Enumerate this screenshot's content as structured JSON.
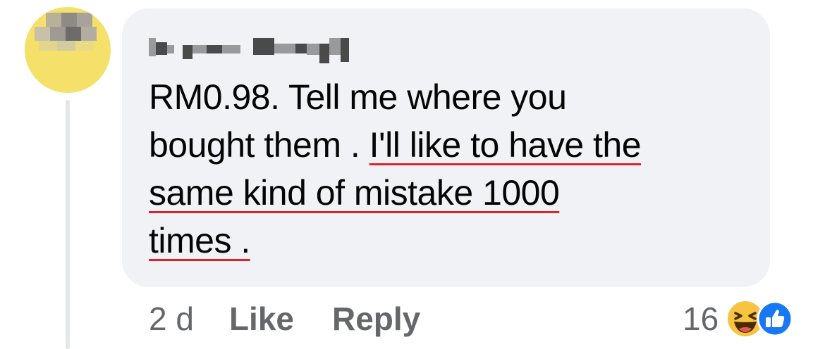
{
  "comment": {
    "text_line1": "RM0.98.  Tell me where you",
    "text_line2_plain": "bought them . ",
    "text_line2_underlined": "I'll like to have the",
    "text_line3_underlined": "same kind of mistake 1000",
    "text_line4_underlined": "times ."
  },
  "actions": {
    "timestamp": "2 d",
    "like_label": "Like",
    "reply_label": "Reply"
  },
  "reactions": {
    "count": "16",
    "icons": [
      "haha-reaction-icon",
      "like-reaction-icon"
    ]
  },
  "colors": {
    "bubble": "#f0f2f5",
    "text": "#050505",
    "secondary": "#65676b",
    "underline": "#e0202a",
    "like_blue": "#1877f2",
    "haha_yellow": "#f7c343"
  }
}
